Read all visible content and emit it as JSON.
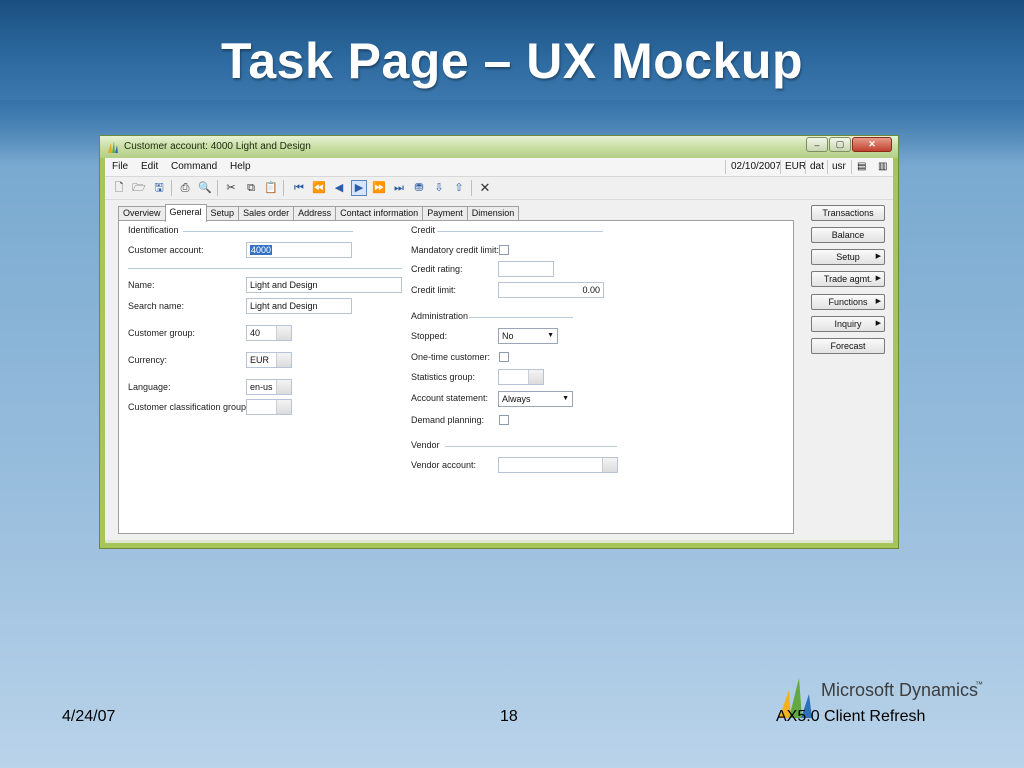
{
  "slide": {
    "title": "Task Page – UX Mockup",
    "date": "4/24/07",
    "page_number": "18",
    "footer_right": "AX5.0 Client Refresh",
    "logo_text": "Microsoft Dynamics",
    "logo_tm": "™"
  },
  "window": {
    "title": "Customer account: 4000 Light and Design",
    "buttons": {
      "minimize": "–",
      "maximize": "▢",
      "close": "✕"
    }
  },
  "menu": {
    "items": [
      "File",
      "Edit",
      "Command",
      "Help"
    ],
    "status": {
      "date": "02/10/2007",
      "currency": "EUR",
      "company": "dat",
      "user": "usr"
    }
  },
  "tabs": [
    "Overview",
    "General",
    "Setup",
    "Sales order",
    "Address",
    "Contact information",
    "Payment",
    "Dimension"
  ],
  "active_tab": "General",
  "form": {
    "identification": {
      "header": "Identification",
      "customer_account_label": "Customer account:",
      "customer_account_value": "4000",
      "name_label": "Name:",
      "name_value": "Light and Design",
      "search_name_label": "Search name:",
      "search_name_value": "Light and Design",
      "customer_group_label": "Customer group:",
      "customer_group_value": "40",
      "currency_label": "Currency:",
      "currency_value": "EUR",
      "language_label": "Language:",
      "language_value": "en-us",
      "classification_label": "Customer classification group:",
      "classification_value": ""
    },
    "credit": {
      "header": "Credit",
      "mandatory_label": "Mandatory credit limit:",
      "rating_label": "Credit rating:",
      "rating_value": "",
      "limit_label": "Credit limit:",
      "limit_value": "0.00"
    },
    "administration": {
      "header": "Administration",
      "stopped_label": "Stopped:",
      "stopped_value": "No",
      "one_time_label": "One-time customer:",
      "statistics_label": "Statistics group:",
      "statistics_value": "",
      "statement_label": "Account statement:",
      "statement_value": "Always",
      "demand_label": "Demand planning:"
    },
    "vendor": {
      "header": "Vendor",
      "account_label": "Vendor account:",
      "account_value": ""
    }
  },
  "side_buttons": [
    "Transactions",
    "Balance",
    "Setup",
    "Trade agmt.",
    "Functions",
    "Inquiry",
    "Forecast"
  ],
  "colors": {
    "accent": "#3370c6",
    "window_frame": "#a8c55a"
  }
}
